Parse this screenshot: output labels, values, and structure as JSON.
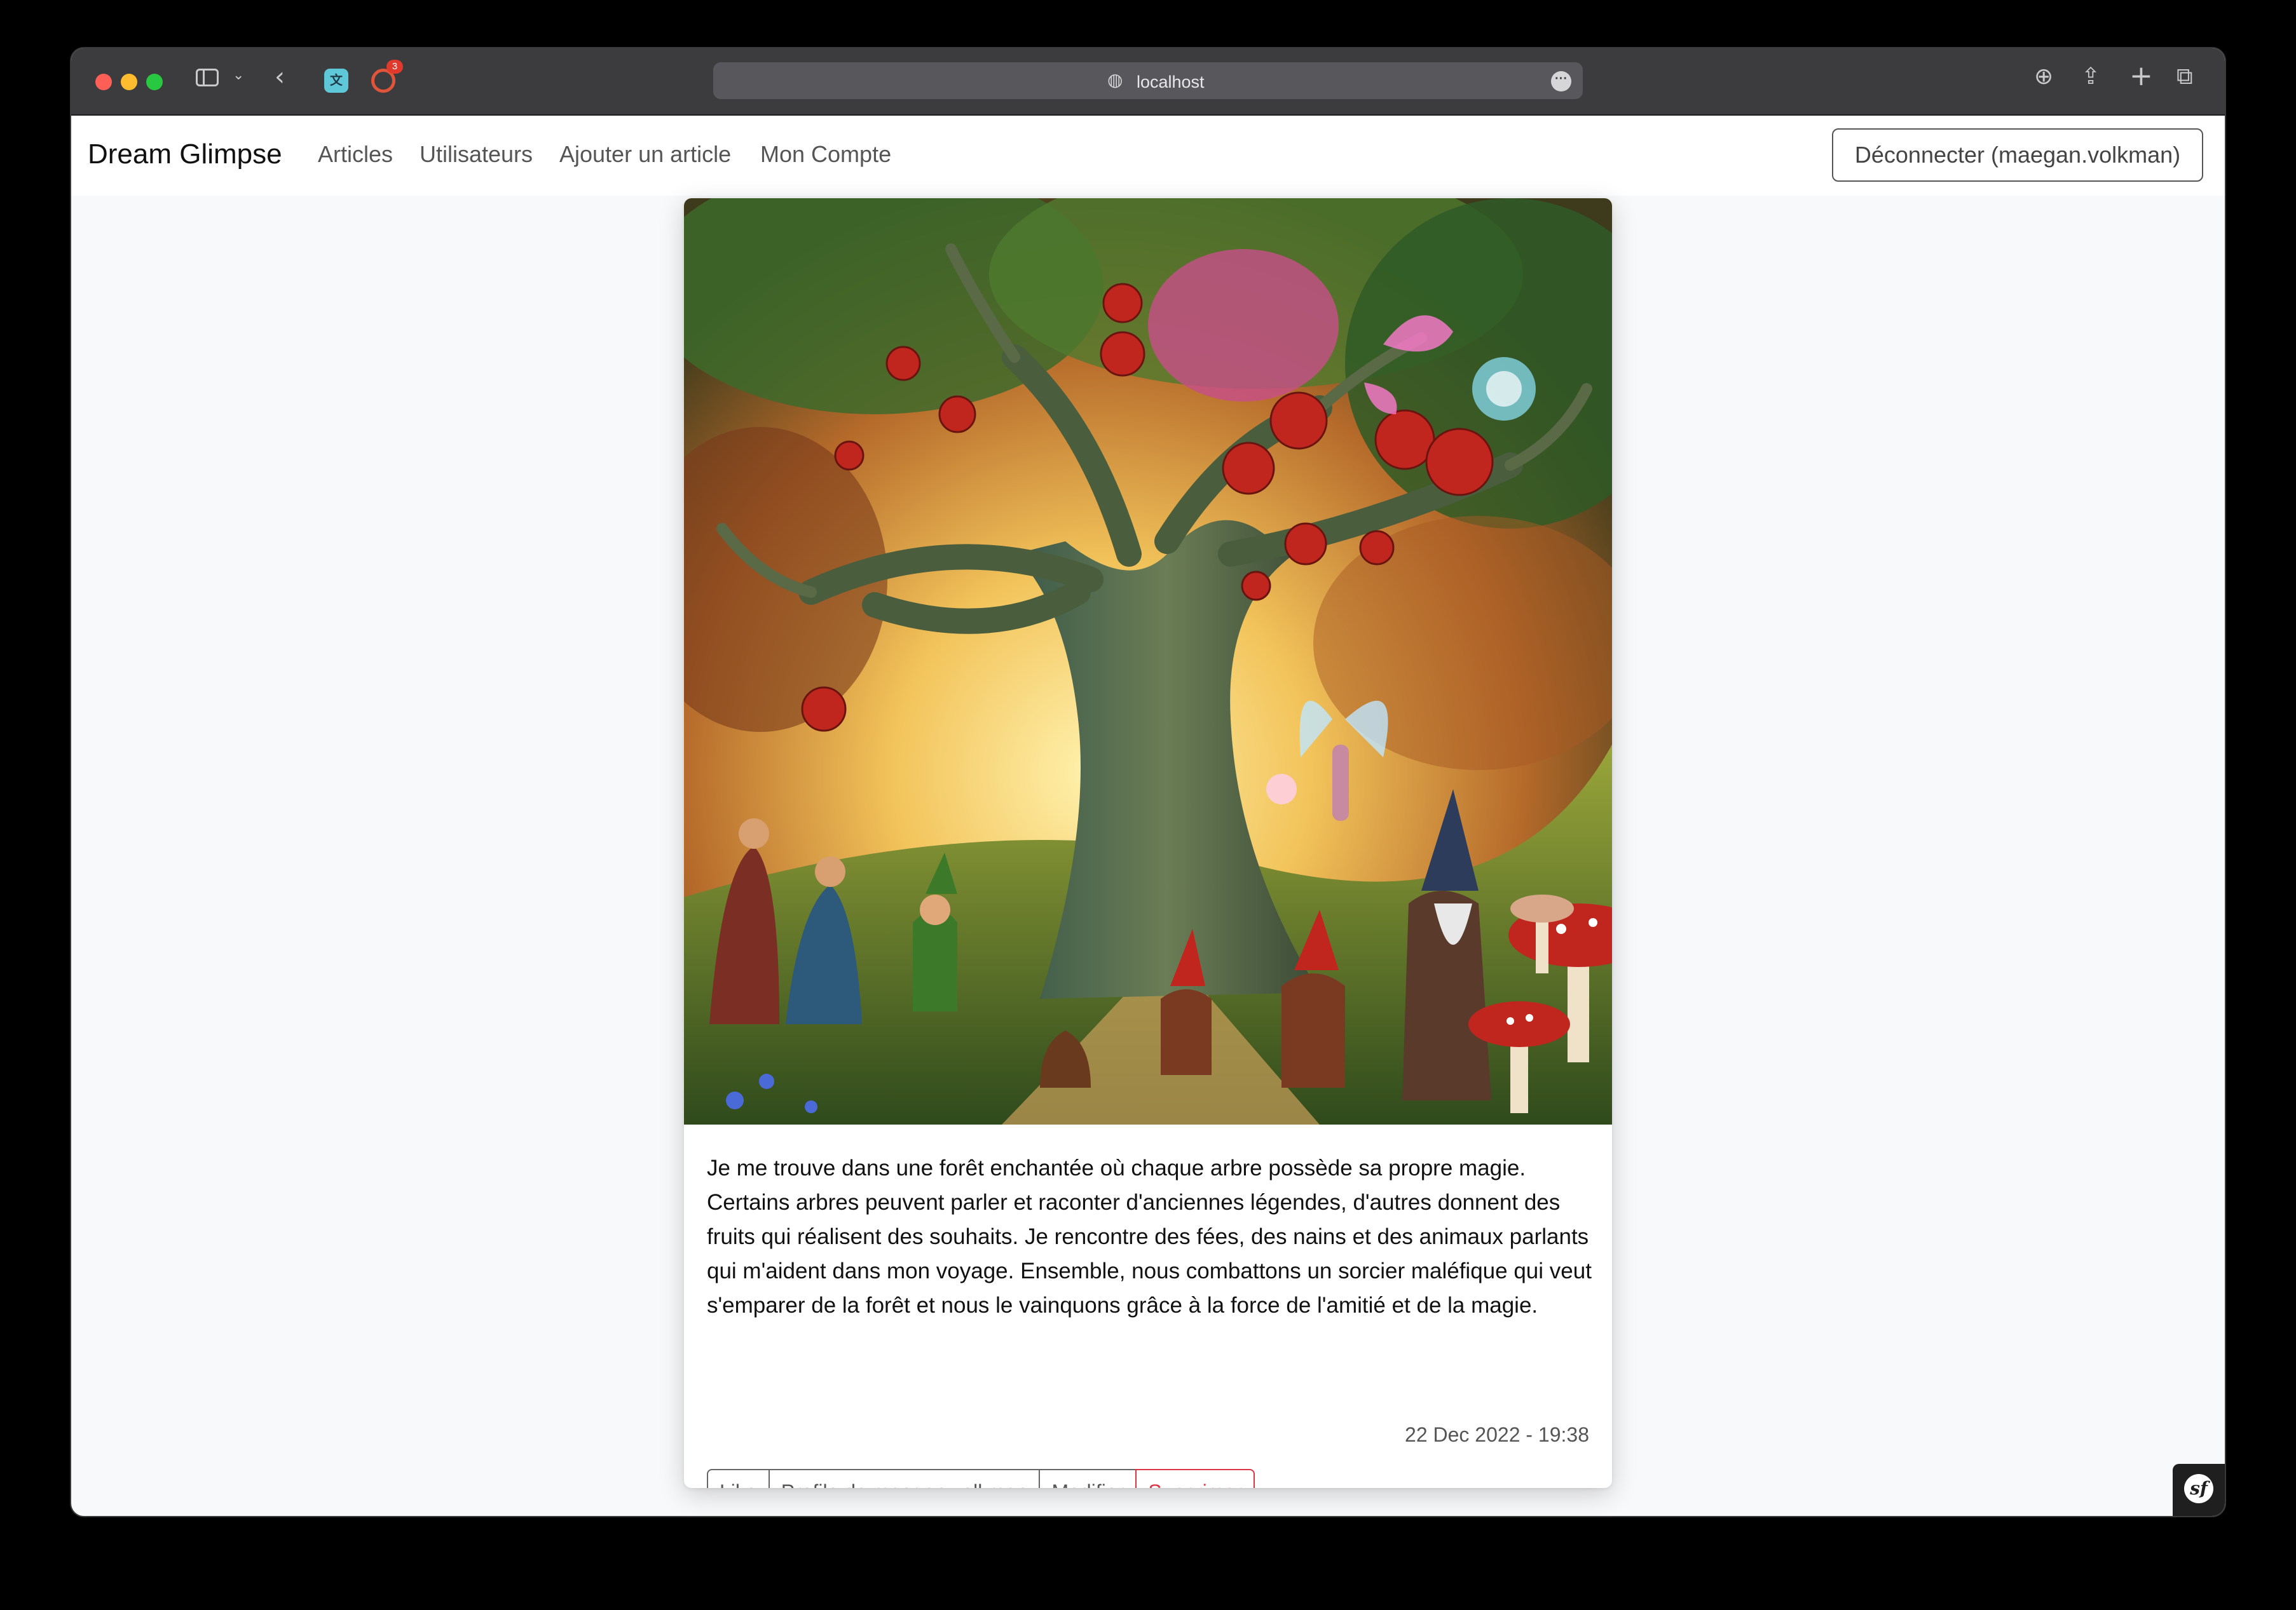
{
  "browser": {
    "url": "localhost",
    "extension_badge_count": "3",
    "icons": [
      "sidebar-toggle-icon",
      "chevron-down-icon",
      "back-arrow-icon",
      "translate-extension-icon",
      "extension-icon",
      "globe-icon",
      "more-icon",
      "download-icon",
      "share-icon",
      "new-tab-icon",
      "tab-overview-icon"
    ]
  },
  "navbar": {
    "brand": "Dream Glimpse",
    "links": [
      "Articles",
      "Utilisateurs",
      "Ajouter un article",
      "Mon Compte"
    ],
    "logout_label": "Déconnecter (maegan.volkman)"
  },
  "article": {
    "image_description": "fantasy forest illustration",
    "text": "Je me trouve dans une forêt enchantée où chaque arbre possède sa propre magie. Certains arbres peuvent parler et raconter d'anciennes légendes, d'autres donnent des fruits qui réalisent des souhaits. Je rencontre des fées, des nains et des animaux parlants qui m'aident dans mon voyage. Ensemble, nous combattons un sorcier maléfique qui veut s'emparer de la forêt et nous le vainquons grâce à la force de l'amitié et de la magie.",
    "date": "22 Dec 2022 - 19:38",
    "buttons": {
      "like": "Like",
      "profile": "Profile de maegan.volkman",
      "edit": "Modifier",
      "delete": "Supprimer"
    }
  },
  "colors": {
    "danger": "#dc3545",
    "navbar_bg": "#ffffff",
    "page_bg": "#f8f9fa"
  }
}
